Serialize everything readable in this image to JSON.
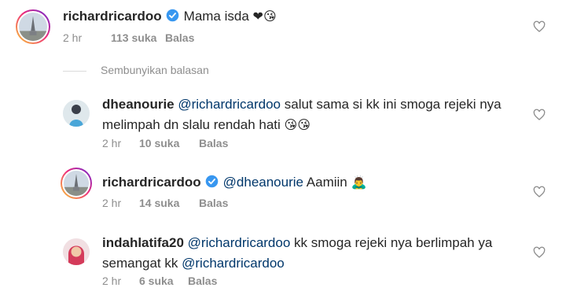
{
  "comments": [
    {
      "username": "richardricardoo",
      "verified": true,
      "text": "Mama isda",
      "emoji": "❤😘",
      "time": "2 hr",
      "likes": "113 suka",
      "reply": "Balas"
    }
  ],
  "hide_replies_label": "Sembunyikan balasan",
  "replies": [
    {
      "username": "dheanourie",
      "mention": "@richardricardoo",
      "text_line1": "salut sama si kk ini smoga rejeki nya",
      "text_line2": "melimpah  dn slalu rendah hati",
      "emoji": "😘😘",
      "time": "2 hr",
      "likes": "10 suka",
      "reply": "Balas"
    },
    {
      "username": "richardricardoo",
      "verified": true,
      "mention": "@dheanourie",
      "text": "Aamiin",
      "emoji": "🙇‍♂️",
      "time": "2 hr",
      "likes": "14 suka",
      "reply": "Balas"
    },
    {
      "username": "indahlatifa20",
      "mention": "@richardricardoo",
      "text_line1": "kk smoga rejeki nya berlimpah ya",
      "text_line2_prefix": "semangat kk",
      "mention2": "@richardricardoo",
      "time": "2 hr",
      "likes": "6 suka",
      "reply": "Balas"
    }
  ],
  "colors": {
    "text": "#262626",
    "muted": "#8e8e8e",
    "mention": "#00376b",
    "verified": "#3897f0"
  },
  "icons": {
    "like": "heart-outline-icon",
    "verified": "verified-badge-icon"
  }
}
